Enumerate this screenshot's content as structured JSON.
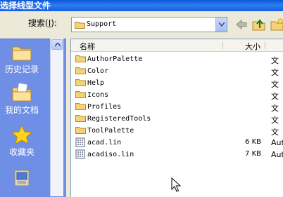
{
  "window": {
    "title": "选择线型文件"
  },
  "toolbar": {
    "search_label": "搜索(",
    "search_key": "I",
    "search_suffix": "):",
    "location_value": "Support",
    "back_icon": "back-arrow-icon",
    "up_icon": "up-folder-icon",
    "new_folder_icon": "new-folder-icon"
  },
  "places": [
    {
      "label": "历史记录",
      "icon": "history-folder-icon"
    },
    {
      "label": "我的文档",
      "icon": "my-documents-icon"
    },
    {
      "label": "收藏夹",
      "icon": "favorites-star-icon"
    },
    {
      "label": "",
      "icon": "desktop-icon"
    }
  ],
  "filelist": {
    "columns": {
      "name": "名称",
      "size": "大小"
    },
    "rows": [
      {
        "name": "AuthorPalette",
        "size": "",
        "type": "文",
        "kind": "folder"
      },
      {
        "name": "Color",
        "size": "",
        "type": "文",
        "kind": "folder"
      },
      {
        "name": "Help",
        "size": "",
        "type": "文",
        "kind": "folder"
      },
      {
        "name": "Icons",
        "size": "",
        "type": "文",
        "kind": "folder"
      },
      {
        "name": "Profiles",
        "size": "",
        "type": "文",
        "kind": "folder"
      },
      {
        "name": "RegisteredTools",
        "size": "",
        "type": "文",
        "kind": "folder"
      },
      {
        "name": "ToolPalette",
        "size": "",
        "type": "文",
        "kind": "folder"
      },
      {
        "name": "acad.lin",
        "size": "6 KB",
        "type": "Aut",
        "kind": "file"
      },
      {
        "name": "acadiso.lin",
        "size": "7 KB",
        "type": "Aut",
        "kind": "file"
      }
    ]
  },
  "colors": {
    "title_bar": "#0a57d6",
    "places_bar": "#6f8fe6",
    "folder": "#f5d27a"
  }
}
